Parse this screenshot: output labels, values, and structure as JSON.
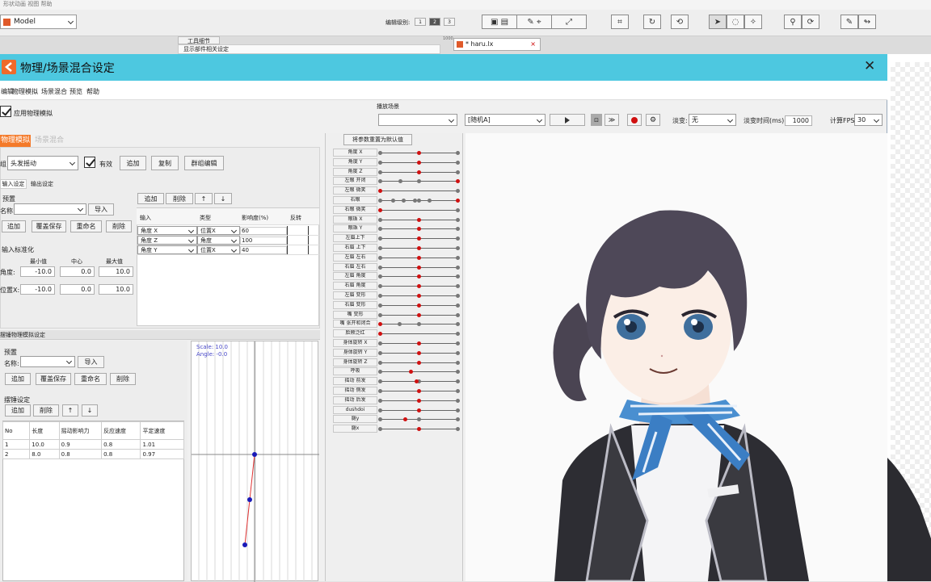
{
  "top_bar": {
    "menu": "形状动画  视图  帮助",
    "model_select": "Model",
    "edit_level_label": "编辑级别:",
    "levels": [
      "1",
      "2",
      "3"
    ],
    "tool_detail_tab": "工具细节",
    "tool_detail_sub": "显示部件相关设定",
    "doc_tab": "* haru.lx",
    "ruler": "1000"
  },
  "dialog": {
    "title": "物理/场景混合设定",
    "close": "✕",
    "menu": [
      "编辑",
      "物理模拟",
      "场景混合",
      "预览",
      "帮助"
    ],
    "apply_physics": "应用物理模拟",
    "scene_label": "播放场景",
    "scene_value": "",
    "random_value": "[随机A]",
    "fade_label": "淡变:",
    "fade_value": "无",
    "fade_time_label": "淡变时间(ms):",
    "fade_time_value": "1000",
    "fps_label": "计算FPS",
    "fps_value": "30"
  },
  "physics": {
    "tabs": [
      "物理模拟",
      "场景混合"
    ],
    "group_label": "组",
    "group_value": "头发摇动",
    "enabled_label": "有效",
    "buttons": [
      "追加",
      "复制",
      "群组编辑"
    ],
    "subtabs": [
      "输入设定",
      "输出设定"
    ],
    "preset_label": "预置",
    "name_label": "名称:",
    "import_label": "导入",
    "preset_buttons": [
      "追加",
      "覆盖保存",
      "重命名",
      "削除"
    ],
    "table_buttons": [
      "追加",
      "削除",
      "↑",
      "↓"
    ],
    "input_headers": [
      "输入",
      "类型",
      "影响度(%)",
      "反转"
    ],
    "input_rows": [
      {
        "input": "角度 X",
        "type": "位置X",
        "weight": "60"
      },
      {
        "input": "角度 Z",
        "type": "角度",
        "weight": "100"
      },
      {
        "input": "角度 Y",
        "type": "位置X",
        "weight": "40"
      }
    ],
    "normalize_label": "输入标准化",
    "norm_headers": [
      "最小值",
      "中心",
      "最大值"
    ],
    "norm_rows": [
      {
        "label": "角度:",
        "min": "-10.0",
        "center": "0.0",
        "max": "10.0"
      },
      {
        "label": "位置X:",
        "min": "-10.0",
        "center": "0.0",
        "max": "10.0"
      }
    ],
    "pendulum_section": "摆锤物理模拟设定",
    "pendulum_preset_label": "预置",
    "pendulum_name_label": "名称:",
    "pendulum_import": "导入",
    "pendulum_buttons": [
      "追加",
      "覆盖保存",
      "重命名",
      "削除"
    ],
    "swing_label": "摆锤设定",
    "swing_buttons": [
      "追加",
      "削除",
      "↑",
      "↓"
    ],
    "swing_headers": [
      "No",
      "长度",
      "摇动影响力",
      "反应速度",
      "平定速度"
    ],
    "swing_rows": [
      [
        "1",
        "10.0",
        "0.9",
        "0.8",
        "1.01"
      ],
      [
        "2",
        "8.0",
        "0.8",
        "0.8",
        "0.97"
      ]
    ],
    "scale_label": "Scale: 10.0",
    "angle_label": "Angle: -0.0",
    "pendulum_points": [
      [
        0,
        0
      ],
      [
        -1,
        1
      ],
      [
        -2,
        2
      ]
    ]
  },
  "params": {
    "reset_button": "将参数重置为默认值",
    "items": [
      {
        "label": "角度 X",
        "value": 0.5,
        "ticks": [
          0,
          0.5,
          1
        ]
      },
      {
        "label": "角度 Y",
        "value": 0.5,
        "ticks": [
          0,
          0.5,
          1
        ]
      },
      {
        "label": "角度 Z",
        "value": 0.5,
        "ticks": [
          0,
          0.5,
          1
        ]
      },
      {
        "label": "左眼  开闭",
        "value": 1.0,
        "ticks": [
          0,
          0.27,
          0.5,
          1
        ]
      },
      {
        "label": "左眼  微笑",
        "value": 0.0,
        "ticks": [
          0,
          1
        ]
      },
      {
        "label": "右眼",
        "value": 1.0,
        "ticks": [
          0,
          0.17,
          0.31,
          0.45,
          0.5,
          0.64,
          1
        ]
      },
      {
        "label": "右眼  微笑",
        "value": 0.0,
        "ticks": [
          0,
          1
        ]
      },
      {
        "label": "眼珠 X",
        "value": 0.5,
        "ticks": [
          0,
          0.5,
          1
        ]
      },
      {
        "label": "眼珠 Y",
        "value": 0.5,
        "ticks": [
          0,
          0.5,
          1
        ]
      },
      {
        "label": "左眉上下",
        "value": 0.5,
        "ticks": [
          0,
          1
        ]
      },
      {
        "label": "右眉  上下",
        "value": 0.5,
        "ticks": [
          0,
          1
        ]
      },
      {
        "label": "左眉  左右",
        "value": 0.5,
        "ticks": [
          0,
          1
        ]
      },
      {
        "label": "右眉  左右",
        "value": 0.5,
        "ticks": [
          0,
          1
        ]
      },
      {
        "label": "左眉  角度",
        "value": 0.5,
        "ticks": [
          0,
          1
        ]
      },
      {
        "label": "右眉  角度",
        "value": 0.5,
        "ticks": [
          0,
          1
        ]
      },
      {
        "label": "左眉  变形",
        "value": 0.5,
        "ticks": [
          0,
          1
        ]
      },
      {
        "label": "右眉  变形",
        "value": 0.5,
        "ticks": [
          0,
          1
        ]
      },
      {
        "label": "嘴  变形",
        "value": 0.5,
        "ticks": [
          0,
          1
        ]
      },
      {
        "label": "嘴  张开和闭合",
        "value": 0.0,
        "ticks": [
          0,
          0.25,
          0.5,
          1
        ]
      },
      {
        "label": "脸颊泛红",
        "value": 0.0,
        "ticks": [
          0,
          1
        ]
      },
      {
        "label": "身体旋转  X",
        "value": 0.5,
        "ticks": [
          0,
          1
        ]
      },
      {
        "label": "身体旋转  Y",
        "value": 0.5,
        "ticks": [
          0,
          1
        ]
      },
      {
        "label": "身体旋转  Z",
        "value": 0.5,
        "ticks": [
          0,
          1
        ]
      },
      {
        "label": "呼吸",
        "value": 0.4,
        "ticks": [
          0,
          1
        ]
      },
      {
        "label": "摇动  前发",
        "value": 0.47,
        "ticks": [
          0,
          0.5,
          1
        ]
      },
      {
        "label": "摇动  侧发",
        "value": 0.5,
        "ticks": [
          0,
          1
        ]
      },
      {
        "label": "摇动  后发",
        "value": 0.5,
        "ticks": [
          0,
          1
        ]
      },
      {
        "label": "dushdoi",
        "value": 0.5,
        "ticks": [
          0,
          0.5,
          1
        ]
      },
      {
        "label": "腿y",
        "value": 0.33,
        "ticks": [
          0,
          0.5,
          1
        ]
      },
      {
        "label": "腿x",
        "value": 0.5,
        "ticks": [
          0,
          0.5,
          1
        ]
      }
    ]
  },
  "colors": {
    "title_bar": "#4dc8e0",
    "tab_active": "#f47a2a",
    "record_red": "#d01010",
    "pendulum_dot": "#1a1ab8",
    "pendulum_line": "#e03030"
  }
}
